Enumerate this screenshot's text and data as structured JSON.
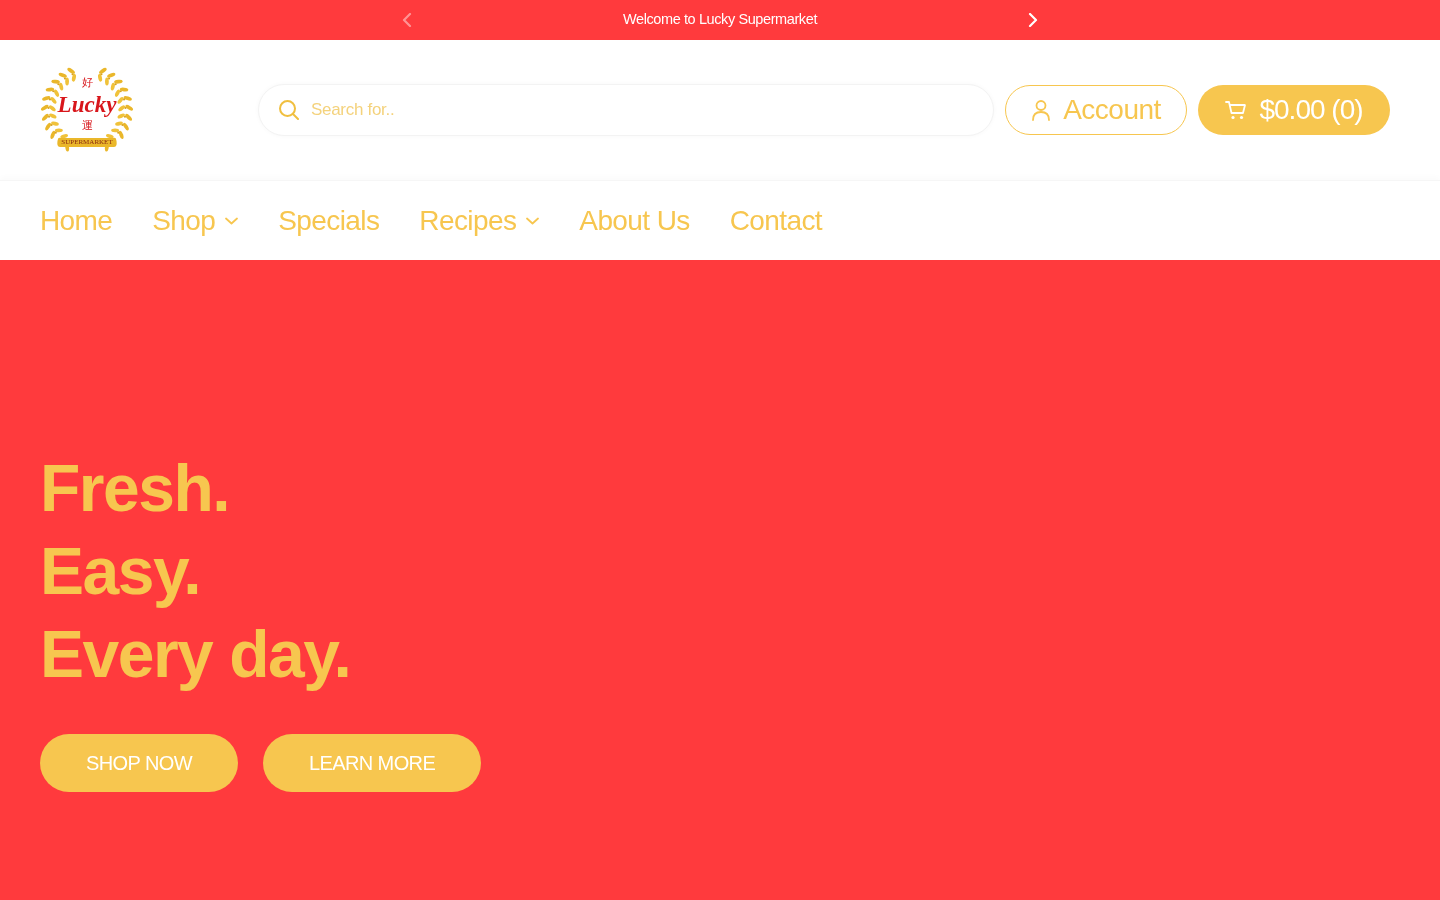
{
  "announcement_bar": {
    "message": "Welcome to Lucky Supermarket",
    "arrows": [
      {
        "kind": "prev",
        "disabled": true
      },
      {
        "kind": "next",
        "disabled": false
      }
    ]
  },
  "header": {
    "logo": {
      "top_character": "好",
      "wordmark": "Lucky",
      "bottom_character": "運",
      "ribbon": "SUPERMARKET"
    },
    "search": {
      "placeholder": "Search for.."
    },
    "account_button": {
      "label": "Account"
    },
    "cart_button": {
      "label": "$0.00 (0)"
    }
  },
  "nav": {
    "items": [
      {
        "label": "Home",
        "dropdown": false
      },
      {
        "label": "Shop",
        "dropdown": true
      },
      {
        "label": "Specials",
        "dropdown": false
      },
      {
        "label": "Recipes",
        "dropdown": true
      },
      {
        "label": "About Us",
        "dropdown": false
      },
      {
        "label": "Contact",
        "dropdown": false
      }
    ]
  },
  "hero": {
    "headline": [
      "Fresh.",
      "Easy.",
      "Every day."
    ],
    "buttons": [
      "SHOP NOW",
      "LEARN MORE"
    ]
  }
}
